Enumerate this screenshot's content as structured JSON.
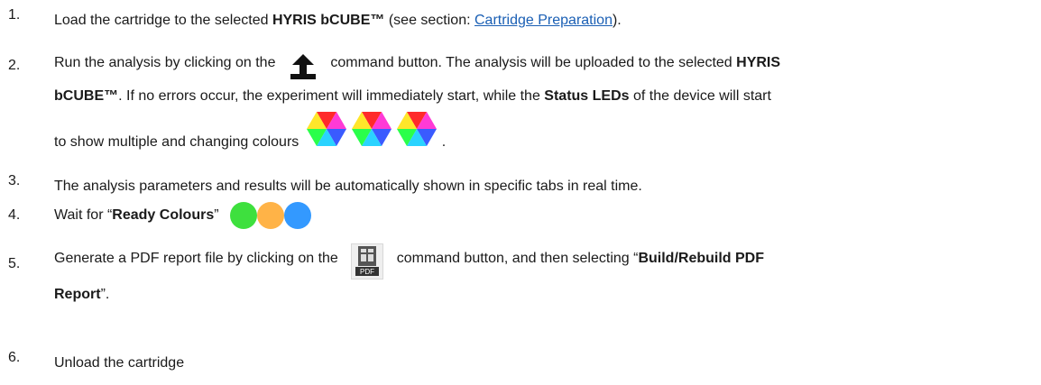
{
  "steps": [
    {
      "num": "1.",
      "t1": "Load the cartridge to the selected ",
      "b1": "HYRIS bCUBE™",
      "t2": " (see section: ",
      "link": "Cartridge Preparation",
      "t3": ")."
    },
    {
      "num": "2.",
      "t1": "Run the analysis by clicking on the",
      "t2": "command button.  The analysis will be uploaded to the selected ",
      "b1": "HYRIS",
      "b2": "bCUBE™",
      "t3": ". If no errors occur, the experiment will immediately start, while the ",
      "b3": "Status LEDs",
      "t4": " of the device will start",
      "t5": "to show multiple and changing colours",
      "t6": "."
    },
    {
      "num": "3.",
      "t1": "The analysis parameters and results will be automatically shown in specific tabs in real time."
    },
    {
      "num": "4.",
      "t1": "Wait for “",
      "b1": "Ready Colours",
      "t2": "”"
    },
    {
      "num": "5.",
      "t1": "Generate a PDF report file by clicking on the",
      "t2": "command button, and then selecting “",
      "b1": "Build/Rebuild PDF",
      "b2": "Report",
      "t3": "”."
    },
    {
      "num": "6.",
      "t1": "Unload the cartridge"
    }
  ],
  "icons": {
    "upload": "upload-icon",
    "pdf": "pdf-report-icon",
    "pdf_label": "PDF",
    "hexagon": "rgb-status-led-icon",
    "ready_colors": [
      "#3ee03e",
      "#ffb347",
      "#3399ff"
    ]
  }
}
